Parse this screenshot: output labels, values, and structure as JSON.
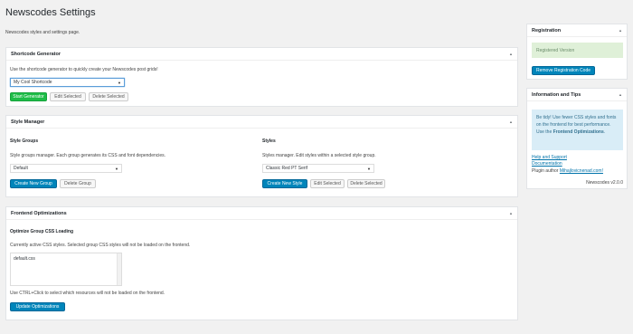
{
  "page": {
    "title": "Newscodes Settings",
    "subtitle": "Newscodes styles and settings page."
  },
  "shortcode": {
    "title": "Shortcode Generator",
    "description": "Use the shortcode generator to quickly create your Newscodes post grids!",
    "select_value": "My Cool Shortcode",
    "start_btn": "Start Generator",
    "edit_btn": "Edit Selected",
    "delete_btn": "Delete Selected"
  },
  "style_manager": {
    "title": "Style Manager",
    "groups": {
      "heading": "Style Groups",
      "description": "Style groups manager. Each group generates its CSS and font dependencies.",
      "select_value": "Default",
      "create_btn": "Create New Group",
      "delete_btn": "Delete Group"
    },
    "styles": {
      "heading": "Styles",
      "description": "Styles manager. Edit styles within a selected style group.",
      "select_value": "Classic Red PT Serif",
      "create_btn": "Create New Style",
      "edit_btn": "Edit Selected",
      "delete_btn": "Delete Selected"
    }
  },
  "frontend": {
    "title": "Frontend Optimizations",
    "heading": "Optimize Group CSS Loading",
    "description": "Currently active CSS styles. Selected group CSS styles will not be loaded on the frontend.",
    "list_item": "default.css",
    "hint": "Use CTRL+Click to select which resources will not be loaded on the frontend.",
    "update_btn": "Update Optimizations"
  },
  "registration": {
    "title": "Registration",
    "status": "Registered Version",
    "remove_btn": "Remove Registration Code"
  },
  "info": {
    "title": "Information and Tips",
    "tip_plain": "Be tidy! Use fewer CSS styles and fonts on the frontend for best performance. Use the ",
    "tip_bold": "Frontend Optimizations",
    "tip_end": ".",
    "help_link": "Help and Support",
    "doc_link": "Documentation",
    "author_label": "Plugin author ",
    "author_link": "Mihajlovicnenad.com!",
    "version": "Newscodes v2.0.0"
  },
  "icons": {
    "collapse": "caret-up-icon",
    "dropdown": "chevron-down-icon"
  },
  "colors": {
    "primary": "#0085ba",
    "green": "#1ebd48",
    "success_bg": "#dff0d8",
    "info_bg": "#d9edf7"
  }
}
